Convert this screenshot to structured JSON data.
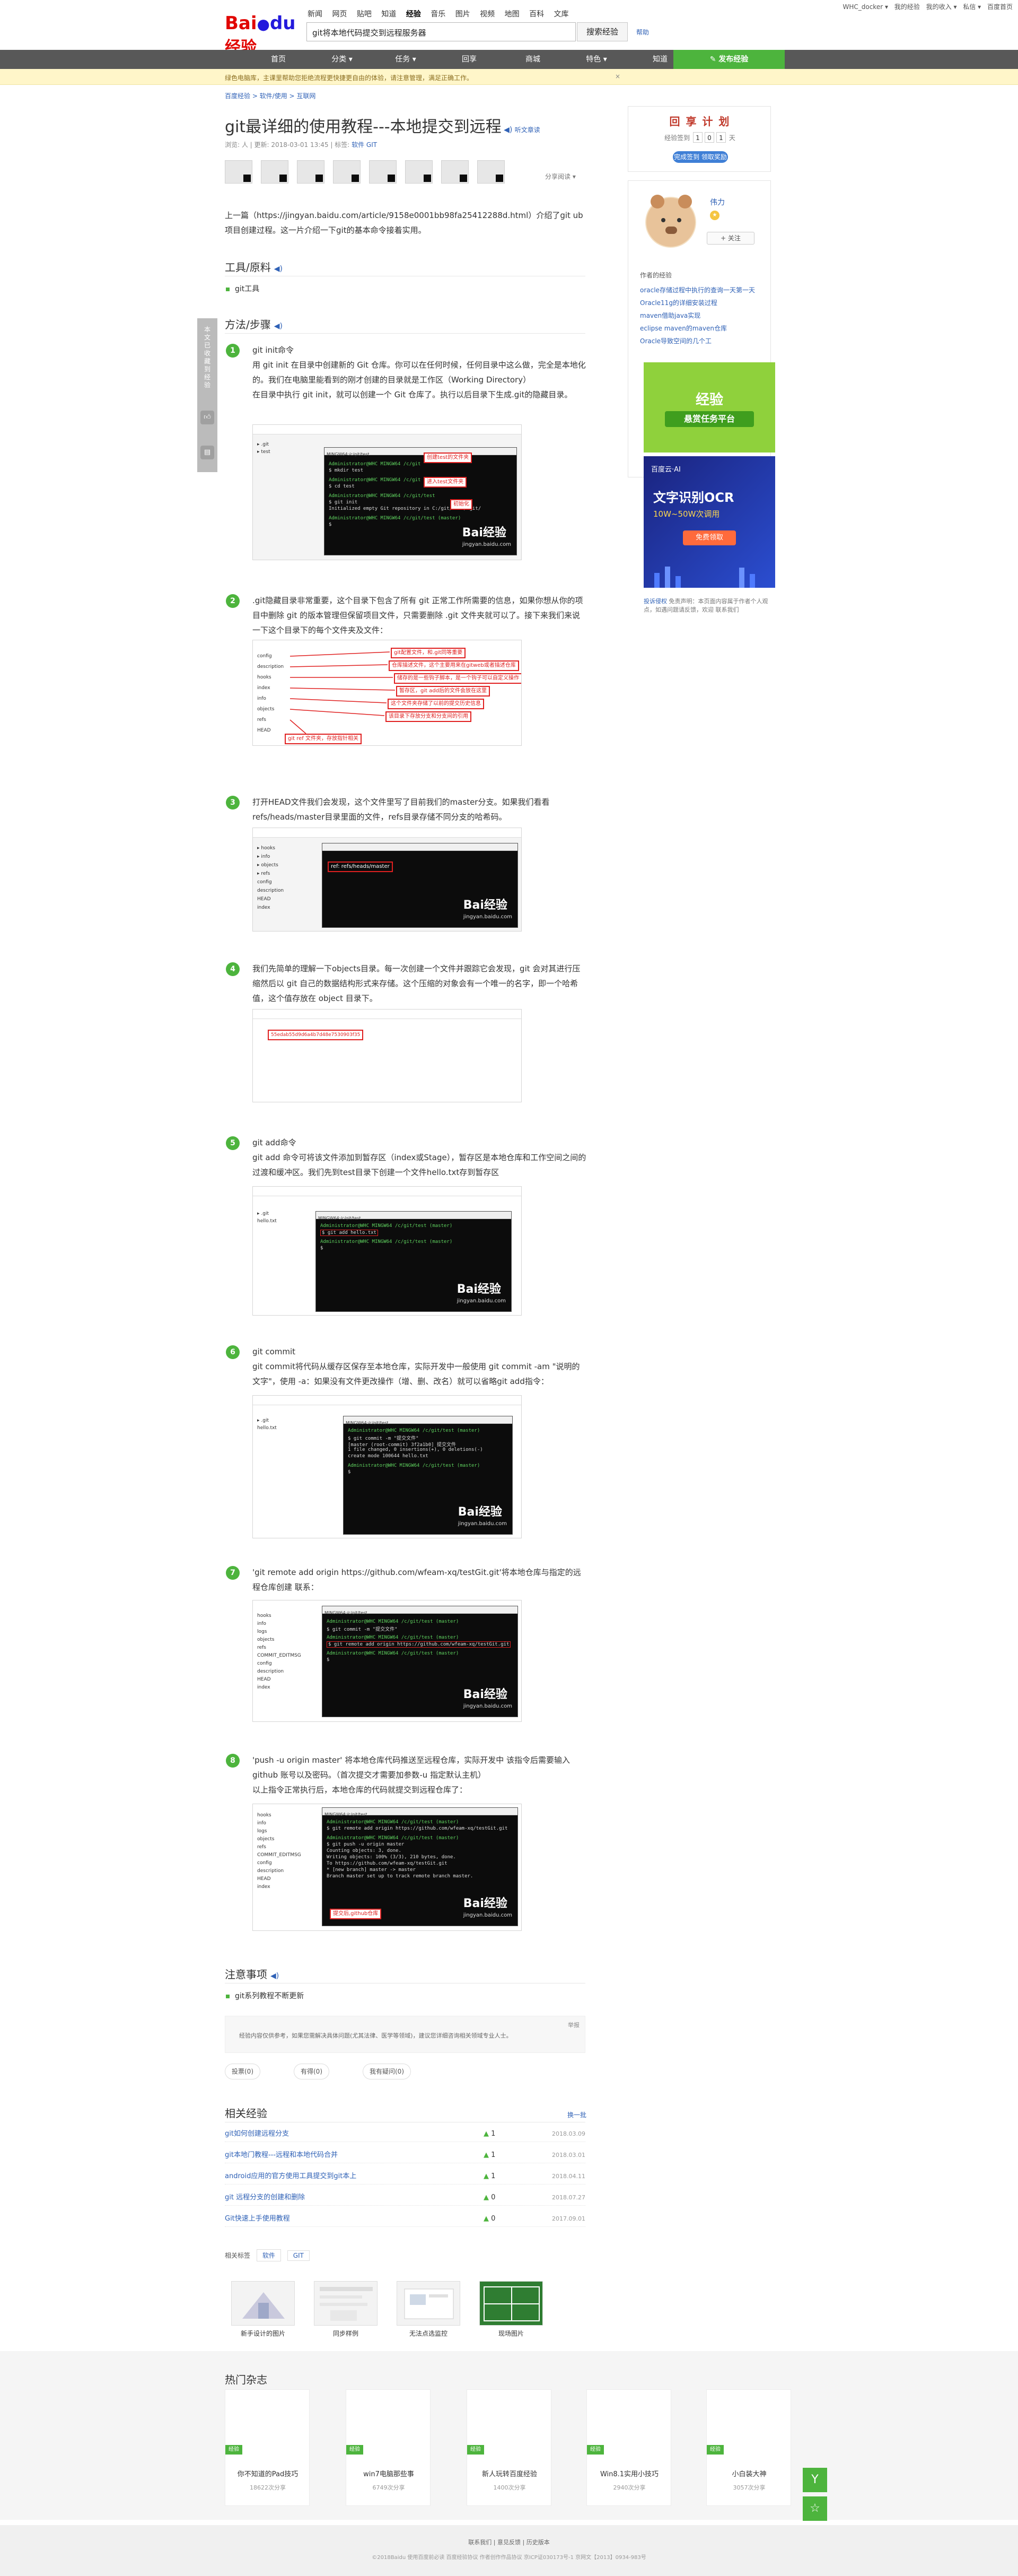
{
  "top": {
    "links": [
      "WHC_docker ▾",
      "我的经验",
      "我的收入 ▾",
      "私信 ▾",
      "百度首页"
    ]
  },
  "logo": {
    "bai": "Bai",
    "du": "du",
    "jy": "经验"
  },
  "channels": [
    "新闻",
    "网页",
    "贴吧",
    "知道",
    "经验",
    "音乐",
    "图片",
    "视频",
    "地图",
    "百科",
    "文库"
  ],
  "search": {
    "value": "git将本地代码提交到远程服务器",
    "button": "搜索经验",
    "help": "帮助"
  },
  "nav": {
    "items": [
      "首页",
      "分类 ▾",
      "任务 ▾",
      "回享",
      "商城",
      "特色 ▾",
      "知道"
    ],
    "share": "发布经验"
  },
  "notice": {
    "text": "绿色电脑库，主课里帮助您拒绝流程更快捷更自由的体验，请注意管理，满足正确工作。",
    "close": "×"
  },
  "breadcrumb": "百度经验 > 软件/使用 > 互联网",
  "article": {
    "title": "git最详细的使用教程---本地提交到远程",
    "listen": "听文章读",
    "meta": "浏览: 人  |  更新: 2018-03-01 13:45  |  标签:",
    "meta_tag": "软件 GIT",
    "share": "分享阅读 ▾",
    "intro": "上一篇（https://jingyan.baidu.com/article/9158e0001bb98fa25412288d.html）介绍了git ub项目创建过程。这一片介绍一下git的基本命令接着实用。"
  },
  "tools": {
    "heading": "工具/原料",
    "items": [
      "git工具"
    ]
  },
  "method": {
    "heading": "方法/步骤"
  },
  "steps": [
    {
      "num": "1",
      "lines": [
        "git init命令",
        "用 git init 在目录中创建新的 Git 仓库。你可以在任何时候，任何目录中这么做，完全是本地化的。我们在电脑里能看到的刚才创建的目录就是工作区（Working Directory）",
        "在目录中执行 git init，就可以创建一个 Git 仓库了。执行以后目录下生成.git的隐藏目录。"
      ],
      "anns": [
        "创建test的文件夹",
        "进入test文件夹",
        "初始化"
      ]
    },
    {
      "num": "2",
      "lines": [
        ".git隐藏目录非常重要，这个目录下包含了所有 git 正常工作所需要的信息，如果你想从你的项目中删除 git 的版本管理但保留项目文件，只需要删除 .git 文件夹就可以了。接下来我们来说一下这个目录下的每个文件夹及文件："
      ],
      "anns": [
        "git配置文件，和.git同等重要",
        "仓库描述文件，这个主要用来在gitweb或者描述仓库",
        "储存的是一些钩子脚本，是一个钩子可以自定义操作",
        "暂存区，git add后的文件会放在这里",
        "这个文件夹存储了以前的提交历史信息",
        "该目录下存放分支和分支间的引用",
        "git ref 文件夹，存放指针相关",
        "git的commit状态的核心"
      ]
    },
    {
      "num": "3",
      "lines": [
        "打开HEAD文件我们会发现，这个文件里写了目前我们的master分支。如果我们看看 refs/heads/master目录里面的文件，refs目录存储不同分支的哈希码。"
      ],
      "anns": [
        "ref: refs/heads/master"
      ]
    },
    {
      "num": "4",
      "lines": [
        "我们先简单的理解一下objects目录。每一次创建一个文件并跟踪它会发现，git 会对其进行压缩然后以 git 自己的数据结构形式来存储。这个压缩的对象会有一个唯一的名字，即一个哈希值，这个值存放在 object 目录下。"
      ],
      "anns": [
        "55edab55d9d6a4b7d48e7530903f35"
      ]
    },
    {
      "num": "5",
      "lines": [
        "git add命令",
        "git add 命令可将该文件添加到暂存区（index或Stage），暂存区是本地仓库和工作空间之间的过渡和缓冲区。我们先到test目录下创建一个文件hello.txt存到暂存区"
      ],
      "anns": []
    },
    {
      "num": "6",
      "lines": [
        "git commit",
        "git commit将代码从缓存区保存至本地仓库，实际开发中一般使用 git commit -am \"说明的文字\"，使用 -a：如果没有文件更改操作（增、删、改名）就可以省略git add指令："
      ],
      "anns": []
    },
    {
      "num": "7",
      "lines": [
        "'git remote add origin https://github.com/wfeam-xq/testGit.git'将本地仓库与指定的远程仓库创建 联系："
      ],
      "anns": []
    },
    {
      "num": "8",
      "lines": [
        "'push -u origin master' 将本地仓库代码推送至远程仓库，实际开发中 该指令后需要输入github 账号以及密码。（首次提交才需要加参数-u 指定默认主机）",
        "以上指令正常执行后，本地仓库的代码就提交到远程仓库了："
      ],
      "anns": [
        "提交后,github仓库"
      ]
    }
  ],
  "watermark": {
    "main": "Bai经验",
    "sub": "jingyan.baidu.com"
  },
  "terminal": {
    "title": "MINGW64:/c/git/test"
  },
  "notes": {
    "heading": "注意事项",
    "items": [
      "git系列教程不断更新"
    ]
  },
  "tip": {
    "text": "经验内容仅供参考，如果您需解决具体问题(尤其法律、医学等领域)，建议您详细咨询相关领域专业人士。",
    "report": "举报"
  },
  "votes": [
    "投票(0)",
    "有得(0)",
    "我有疑问(0)"
  ],
  "related": {
    "heading": "相关经验",
    "more": "换一批",
    "rows": [
      {
        "title": "git如何创建远程分支",
        "n": "1",
        "date": "2018.03.09"
      },
      {
        "title": "git本地门教程---远程和本地代码合并",
        "n": "1",
        "date": "2018.03.01"
      },
      {
        "title": "android应用的官方使用工具提交到git本上",
        "n": "1",
        "date": "2018.04.11"
      },
      {
        "title": "git 远程分支的创建和删除",
        "n": "0",
        "date": "2018.07.27"
      },
      {
        "title": "Git快速上手使用教程",
        "n": "0",
        "date": "2017.09.01"
      }
    ]
  },
  "tags": {
    "label": "相关标签",
    "items": [
      "软件",
      "GIT"
    ]
  },
  "recos": [
    {
      "label": "新手设计的图片"
    },
    {
      "label": "同步样例"
    },
    {
      "label": "无法点选监控"
    },
    {
      "label": "现场图片"
    }
  ],
  "sidebar": {
    "plan": "回 享 计 划",
    "days_label": "经验签到",
    "days": [
      "1",
      "0",
      "1"
    ],
    "days_suffix": "天",
    "plan_btn": "完成签到 领取奖励",
    "author": "伟力",
    "follow": "+ 关注",
    "list_head": "作者的经验",
    "list": [
      "oracle存储过程中执行的查询一天第一天",
      "Oracle11g的详细安装过程",
      "maven借助java实现",
      "eclipse maven的maven仓库",
      "Oracle导致空间的几个工"
    ],
    "ad1_title": "经验",
    "ad1_sub": "悬赏任务平台",
    "ad2_brand": "百度云·AI",
    "ad2_title": "文字识别OCR",
    "ad2_sub": "10W~50W次调用",
    "ad2_btn": "免费领取",
    "report": "免责声明：本页面内容属于作者个人观点，如遇问题请反馈，欢迎 联系我们",
    "report_link": "投诉侵权"
  },
  "floatbar": {
    "text": "本文已收藏到经验"
  },
  "hot": {
    "heading": "热门杂志",
    "items": [
      {
        "tag": "经验",
        "title": "你不知道的Pad技巧",
        "views": "18622次分享"
      },
      {
        "tag": "经验",
        "title": "win7电脑那些事",
        "views": "6749次分享"
      },
      {
        "tag": "经验",
        "title": "新人玩转百度经验",
        "views": "1400次分享"
      },
      {
        "tag": "经验",
        "title": "Win8.1实用小技巧",
        "views": "2940次分享"
      },
      {
        "tag": "经验",
        "title": "小白装大神",
        "views": "3057次分享"
      }
    ]
  },
  "footer": {
    "l1": "联系我们  |  意见反馈  |  历史版本",
    "l2": "©2018Baidu  使用百度前必读  百度经验协议  作者创作作品协议  京ICP证030173号-1  京网文【2013】0934-983号"
  },
  "fbtns": [
    "Y",
    "☆",
    "▯"
  ]
}
